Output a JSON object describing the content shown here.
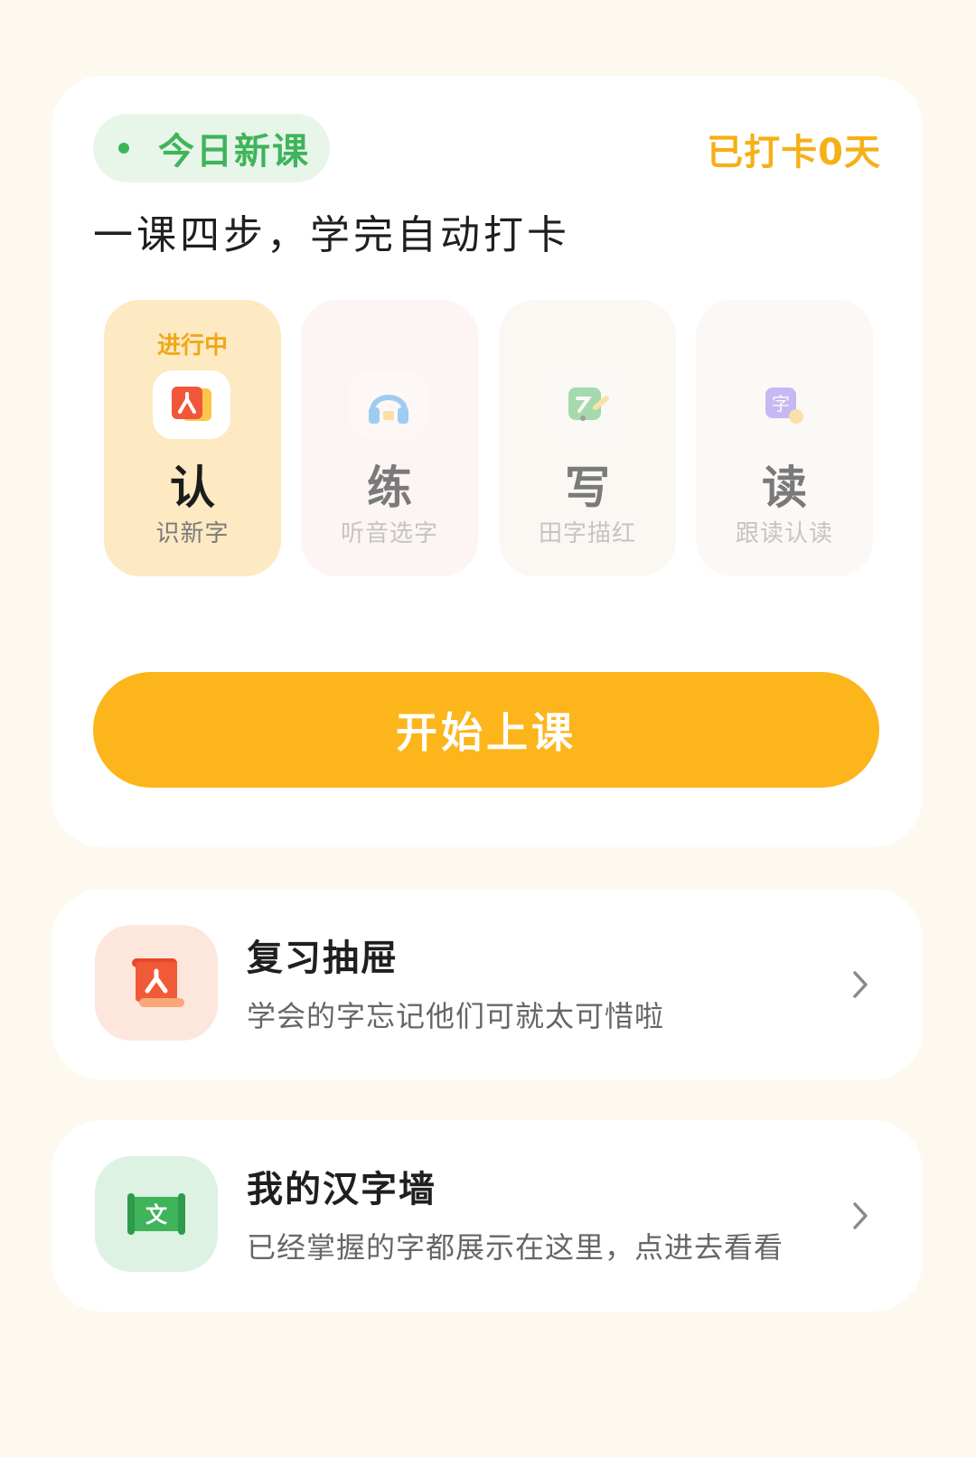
{
  "lesson": {
    "badge_label": "今日新课",
    "checkin_text": "已打卡0天",
    "subtitle": "一课四步，学完自动打卡",
    "steps": [
      {
        "status": "进行中",
        "char": "认",
        "desc": "识新字",
        "icon": "recognize-card-icon"
      },
      {
        "status": "",
        "char": "练",
        "desc": "听音选字",
        "icon": "headphones-icon"
      },
      {
        "status": "",
        "char": "写",
        "desc": "田字描红",
        "icon": "pencil-board-icon"
      },
      {
        "status": "",
        "char": "读",
        "desc": "跟读认读",
        "icon": "character-bubble-icon"
      }
    ],
    "start_button_label": "开始上课"
  },
  "features": {
    "review": {
      "title": "复习抽屉",
      "desc": "学会的字忘记他们可就太可惜啦",
      "icon": "scroll-icon"
    },
    "wall": {
      "title": "我的汉字墙",
      "desc": "已经掌握的字都展示在这里，点进去看看",
      "icon": "wall-scroll-icon"
    }
  },
  "colors": {
    "accent_orange": "#fcb51a",
    "accent_green": "#3fb45b",
    "background": "#fdf9ef"
  }
}
